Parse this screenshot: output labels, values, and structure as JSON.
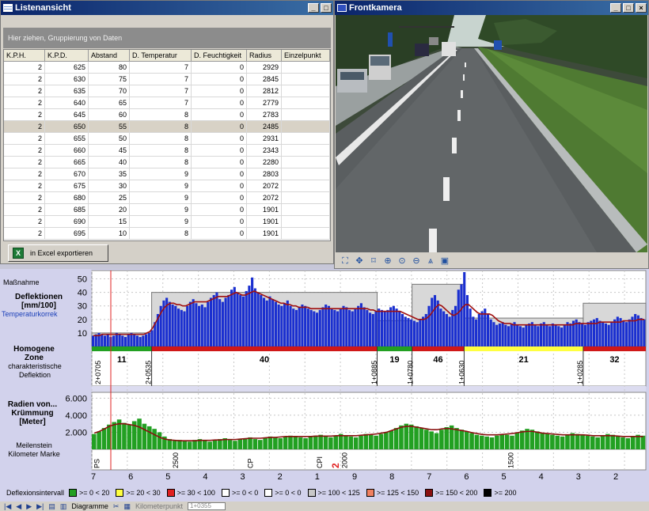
{
  "list_window": {
    "title": "Listenansicht",
    "group_hint": "Hier ziehen, Gruppierung von Daten",
    "columns": [
      "K.P.H.",
      "K.P.D.",
      "Abstand",
      "D. Temperatur",
      "D. Feuchtigkeit",
      "Radius",
      "Einzelpunkt"
    ],
    "rows": [
      [
        "2",
        "625",
        "80",
        "7",
        "0",
        "2929",
        ""
      ],
      [
        "2",
        "630",
        "75",
        "7",
        "0",
        "2845",
        ""
      ],
      [
        "2",
        "635",
        "70",
        "7",
        "0",
        "2812",
        ""
      ],
      [
        "2",
        "640",
        "65",
        "7",
        "0",
        "2779",
        ""
      ],
      [
        "2",
        "645",
        "60",
        "8",
        "0",
        "2783",
        ""
      ],
      [
        "2",
        "650",
        "55",
        "8",
        "0",
        "2485",
        ""
      ],
      [
        "2",
        "655",
        "50",
        "8",
        "0",
        "2931",
        ""
      ],
      [
        "2",
        "660",
        "45",
        "8",
        "0",
        "2343",
        ""
      ],
      [
        "2",
        "665",
        "40",
        "8",
        "0",
        "2280",
        ""
      ],
      [
        "2",
        "670",
        "35",
        "9",
        "0",
        "2803",
        ""
      ],
      [
        "2",
        "675",
        "30",
        "9",
        "0",
        "2072",
        ""
      ],
      [
        "2",
        "680",
        "25",
        "9",
        "0",
        "2072",
        ""
      ],
      [
        "2",
        "685",
        "20",
        "9",
        "0",
        "1901",
        ""
      ],
      [
        "2",
        "690",
        "15",
        "9",
        "0",
        "1901",
        ""
      ],
      [
        "2",
        "695",
        "10",
        "8",
        "0",
        "1901",
        ""
      ]
    ],
    "selected_row": 5,
    "export_label": "in Excel exportieren"
  },
  "camera_window": {
    "title": "Frontkamera"
  },
  "chart_panel": {
    "labels": {
      "massnahme": "Maßnahme",
      "deflektionen": "Deflektionen [mm/100]",
      "temperaturkorrektur": "Temperaturkorrek",
      "homogene_zone": "Homogene Zone",
      "char_deflektion": "charakteristische Deflektion",
      "radien": "Radien von... Krümmung [Meter]",
      "meilenstein": "Meilenstein Kilometer Marke"
    }
  },
  "chart_data": [
    {
      "type": "bar",
      "name": "deflection",
      "y_ticks": [
        10,
        20,
        30,
        40,
        50
      ],
      "ylim": [
        0,
        55
      ],
      "series_color": "#1a2fd0",
      "trend_color": "#a01010",
      "segment_levels": [
        10,
        40,
        19,
        46,
        21,
        32
      ],
      "values": [
        8,
        9,
        10,
        9,
        8,
        9,
        7,
        8,
        10,
        9,
        8,
        7,
        9,
        10,
        9,
        8,
        7,
        8,
        9,
        10,
        12,
        18,
        24,
        30,
        34,
        36,
        33,
        31,
        30,
        28,
        27,
        26,
        30,
        33,
        35,
        32,
        30,
        31,
        29,
        33,
        36,
        38,
        40,
        35,
        33,
        36,
        38,
        42,
        44,
        40,
        38,
        37,
        41,
        45,
        51,
        43,
        40,
        38,
        36,
        34,
        37,
        35,
        33,
        31,
        30,
        32,
        34,
        30,
        28,
        27,
        29,
        31,
        30,
        28,
        27,
        26,
        25,
        27,
        29,
        31,
        30,
        28,
        27,
        26,
        28,
        30,
        29,
        27,
        26,
        28,
        30,
        32,
        29,
        27,
        25,
        24,
        26,
        28,
        27,
        26,
        27,
        29,
        30,
        28,
        26,
        24,
        22,
        21,
        20,
        19,
        18,
        20,
        22,
        24,
        30,
        36,
        38,
        34,
        28,
        26,
        24,
        22,
        27,
        30,
        42,
        46,
        55,
        38,
        28,
        22,
        20,
        24,
        26,
        28,
        24,
        20,
        18,
        16,
        17,
        18,
        16,
        15,
        17,
        18,
        16,
        15,
        14,
        16,
        17,
        18,
        16,
        15,
        17,
        18,
        16,
        15,
        17,
        16,
        15,
        14,
        16,
        18,
        17,
        19,
        20,
        18,
        17,
        16,
        18,
        19,
        20,
        21,
        19,
        18,
        17,
        16,
        18,
        20,
        22,
        21,
        19,
        18,
        20,
        22,
        24,
        23,
        21,
        20
      ],
      "trend": [
        8,
        8,
        8,
        9,
        9,
        9,
        9,
        9,
        9,
        9,
        9,
        9,
        9,
        9,
        9,
        9,
        9,
        9,
        10,
        11,
        14,
        18,
        22,
        26,
        29,
        31,
        32,
        32,
        31,
        31,
        30,
        30,
        31,
        32,
        33,
        33,
        33,
        33,
        33,
        34,
        35,
        36,
        37,
        37,
        37,
        37,
        38,
        39,
        40,
        39,
        38,
        38,
        39,
        40,
        41,
        40,
        39,
        38,
        37,
        36,
        35,
        34,
        33,
        32,
        32,
        31,
        31,
        30,
        30,
        29,
        29,
        29,
        29,
        28,
        28,
        28,
        28,
        28,
        28,
        28,
        28,
        28,
        28,
        28,
        28,
        28,
        28,
        28,
        28,
        28,
        28,
        28,
        28,
        27,
        27,
        26,
        26,
        26,
        26,
        26,
        26,
        26,
        26,
        26,
        25,
        24,
        23,
        22,
        21,
        20,
        20,
        20,
        21,
        23,
        26,
        29,
        31,
        30,
        28,
        26,
        24,
        23,
        24,
        26,
        29,
        31,
        31,
        29,
        27,
        25,
        24,
        24,
        24,
        24,
        23,
        21,
        19,
        18,
        17,
        17,
        17,
        16,
        16,
        16,
        16,
        16,
        16,
        16,
        16,
        16,
        16,
        16,
        16,
        16,
        16,
        16,
        16,
        16,
        16,
        16,
        16,
        16,
        17,
        17,
        17,
        17,
        17,
        17,
        17,
        17,
        18,
        18,
        18,
        18,
        18,
        18,
        18,
        18,
        19,
        19,
        19,
        19,
        19,
        20,
        20,
        20
      ]
    },
    {
      "type": "bar",
      "name": "curvature_radius",
      "y_ticks": [
        "2.000",
        "4.000",
        "6.000"
      ],
      "ylim": [
        0,
        6500
      ],
      "series_color": "#22a022",
      "trend_color": "#8a1010",
      "values": [
        1800,
        2100,
        2500,
        2900,
        3200,
        3500,
        3100,
        2900,
        3300,
        3600,
        3000,
        2700,
        2400,
        2000,
        1500,
        1200,
        1000,
        1100,
        1000,
        900,
        1100,
        1200,
        1000,
        900,
        1100,
        1200,
        1300,
        1100,
        1000,
        1200,
        1300,
        1400,
        1200,
        1100,
        1300,
        1500,
        1400,
        1300,
        1500,
        1600,
        1500,
        1400,
        1300,
        1500,
        1600,
        1700,
        1500,
        1400,
        1600,
        1800,
        1600,
        1500,
        1400,
        1600,
        1800,
        1700,
        1600,
        1800,
        2000,
        2200,
        2500,
        2800,
        3000,
        2900,
        2700,
        2500,
        2300,
        2100,
        1900,
        2300,
        2600,
        2800,
        2500,
        2300,
        2100,
        1900,
        1700,
        1600,
        1500,
        1400,
        1600,
        1800,
        1700,
        1600,
        1900,
        2200,
        2400,
        2300,
        2100,
        1900,
        1800,
        1700,
        1600,
        1500,
        1700,
        1900,
        1800,
        1700,
        1600,
        1500,
        1400,
        1600,
        1800,
        1700,
        1500,
        1400,
        1300,
        1500,
        1700,
        1600
      ],
      "trend": [
        1900,
        2100,
        2400,
        2700,
        2900,
        3000,
        3000,
        2900,
        2800,
        2600,
        2300,
        2000,
        1700,
        1400,
        1200,
        1100,
        1050,
        1000,
        1000,
        1000,
        1000,
        1050,
        1050,
        1050,
        1100,
        1100,
        1150,
        1150,
        1150,
        1200,
        1250,
        1300,
        1300,
        1300,
        1350,
        1400,
        1400,
        1450,
        1500,
        1500,
        1500,
        1500,
        1500,
        1500,
        1550,
        1550,
        1550,
        1550,
        1600,
        1600,
        1600,
        1600,
        1600,
        1650,
        1700,
        1750,
        1800,
        1900,
        2000,
        2200,
        2400,
        2600,
        2700,
        2700,
        2600,
        2500,
        2400,
        2300,
        2300,
        2400,
        2450,
        2400,
        2300,
        2200,
        2100,
        1950,
        1850,
        1750,
        1700,
        1700,
        1700,
        1750,
        1800,
        1850,
        1950,
        2050,
        2100,
        2100,
        2000,
        1900,
        1850,
        1800,
        1750,
        1700,
        1700,
        1700,
        1700,
        1700,
        1650,
        1600,
        1600,
        1600,
        1600,
        1600,
        1550,
        1500,
        1500,
        1500,
        1500,
        1500
      ]
    }
  ],
  "zones": [
    {
      "value": "11",
      "color": "#22a022"
    },
    {
      "value": "40",
      "color": "#d01818"
    },
    {
      "value": "19",
      "color": "#22a022"
    },
    {
      "value": "46",
      "color": "#d01818"
    },
    {
      "value": "21",
      "color": "#ffff40"
    },
    {
      "value": "32",
      "color": "#d01818"
    }
  ],
  "zone_markers": [
    "2+0705",
    "2+0535",
    "1+0885",
    "1+0780",
    "1+0630",
    "1+0285"
  ],
  "milestones": [
    "PS",
    "2500",
    "CP",
    "CPI",
    "2",
    "2000",
    "1500"
  ],
  "km_axis": [
    "7",
    "6",
    "5",
    "4",
    "3",
    "2",
    "1",
    "9",
    "8",
    "7",
    "6",
    "5",
    "4",
    "3",
    "2"
  ],
  "legend": {
    "title": "Deflexionsintervall",
    "items": [
      {
        "label": ">= 0 < 20",
        "color": "#22a022"
      },
      {
        "label": ">= 20 < 30",
        "color": "#ffff40"
      },
      {
        "label": ">= 30 < 100",
        "color": "#e02020"
      },
      {
        "label": ">= 0 < 0",
        "color": "#ffffff"
      },
      {
        "label": ">= 0 < 0",
        "color": "#ffffff"
      },
      {
        "label": ">= 100 < 125",
        "color": "#c8c8c8"
      },
      {
        "label": ">= 125 < 150",
        "color": "#f08060"
      },
      {
        "label": ">= 150 < 200",
        "color": "#8a1010"
      },
      {
        "label": ">= 200",
        "color": "#000000"
      }
    ]
  },
  "bottom_bar": {
    "diagram_label": "Diagramme",
    "km_label": "Kilometerpunkt",
    "km_value": "1+0355"
  }
}
